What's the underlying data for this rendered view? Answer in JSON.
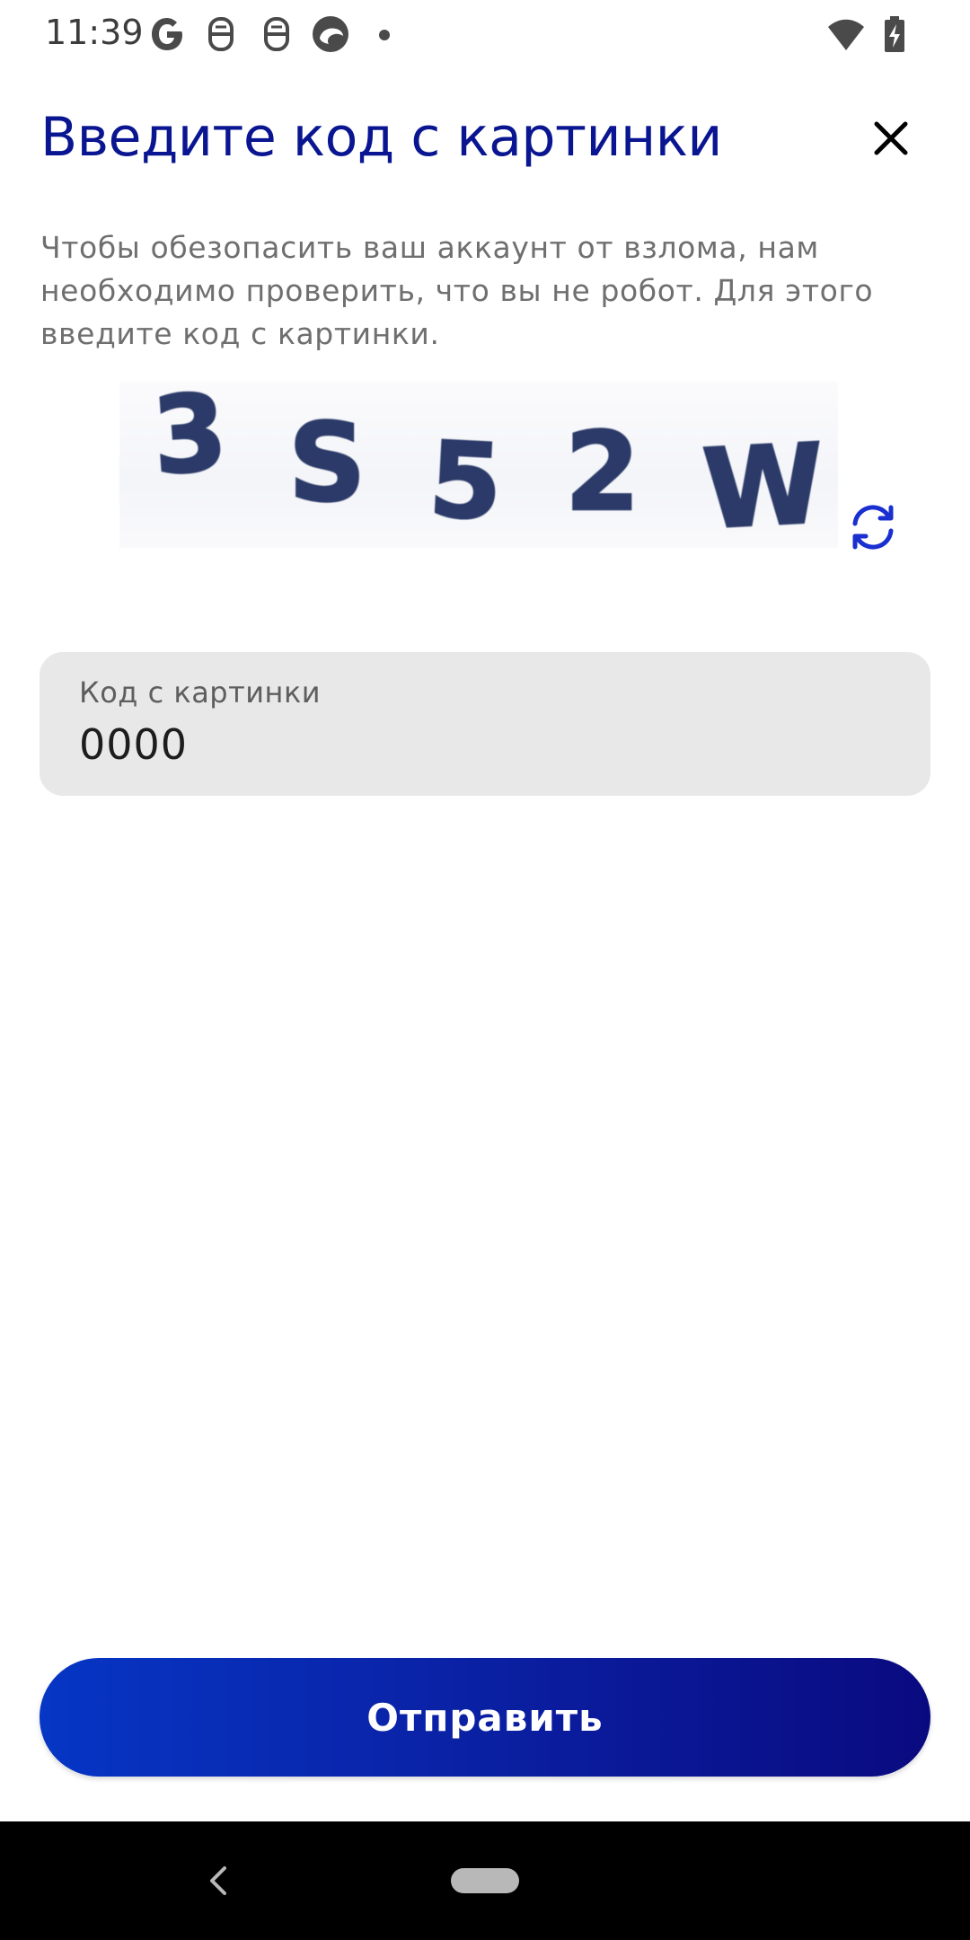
{
  "status_bar": {
    "time": "11:39",
    "icons": [
      "google-icon",
      "notification-app-icon",
      "notification-app-icon",
      "browser-icon",
      "more-dot-icon",
      "wifi-icon",
      "battery-charging-icon"
    ]
  },
  "header": {
    "title": "Введите код с картинки",
    "close_icon": "close-icon"
  },
  "description": "Чтобы обезопасить ваш аккаунт от взлома, нам необходимо проверить, что вы не робот. Для этого введите код с картинки.",
  "captcha": {
    "characters": [
      "3",
      "S",
      "5",
      "2",
      "W"
    ],
    "refresh_icon": "refresh-icon"
  },
  "code_field": {
    "label": "Код с картинки",
    "value": "0000"
  },
  "submit": {
    "label": "Отправить"
  },
  "colors": {
    "title": "#0a1591",
    "accent": "#1a2fd0",
    "button_start": "#0636c5",
    "button_end": "#0a0a80",
    "field_bg": "#e8e8e8",
    "captcha_ink": "#2b3a68"
  },
  "nav_bar": {
    "icons": [
      "back-icon",
      "home-pill"
    ]
  }
}
